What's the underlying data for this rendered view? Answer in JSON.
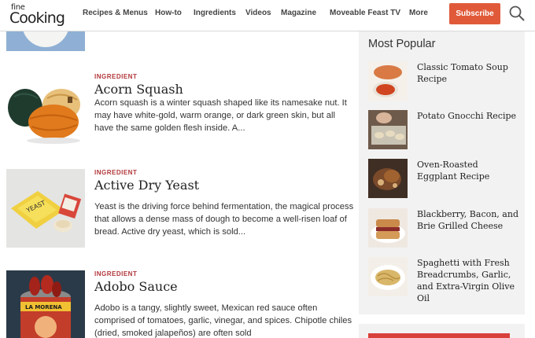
{
  "header": {
    "logo_small": "fine",
    "logo_big": "Cooking",
    "nav": [
      "Recipes & Menus",
      "How-to",
      "Ingredients",
      "Videos",
      "Magazine",
      "Moveable Feast TV",
      "More"
    ],
    "subscribe_label": "Subscribe"
  },
  "articles": [
    {
      "kicker": "INGREDIENT",
      "title": "Acorn Squash",
      "description": "Acorn squash is a winter squash shaped like its namesake nut. It may have white-gold, warm orange, or dark green skin, but all have the same golden flesh inside. A..."
    },
    {
      "kicker": "INGREDIENT",
      "title": "Active Dry Yeast",
      "description": "Yeast is the driving force behind fermentation, the magical process that allows a dense mass of dough to become a well-risen loaf of bread. Active dry yeast, which is sold..."
    },
    {
      "kicker": "INGREDIENT",
      "title": "Adobo Sauce",
      "description": "Adobo is a tangy, slightly sweet, Mexican red sauce often comprised of tomatoes, garlic, vinegar, and spices. Chipotle chiles (dried, smoked jalapeños) are often sold"
    }
  ],
  "sidebar": {
    "title": "Most Popular",
    "items": [
      {
        "title": "Classic Tomato Soup Recipe"
      },
      {
        "title": "Potato Gnocchi Recipe"
      },
      {
        "title": "Oven-Roasted Eggplant Recipe"
      },
      {
        "title": "Blackberry, Bacon, and Brie Grilled Cheese"
      },
      {
        "title": "Spaghetti with Fresh Breadcrumbs, Garlic, and Extra-Virgin Olive Oil"
      }
    ]
  },
  "colors": {
    "accent": "#e05a3a",
    "kicker": "#b2363a",
    "sidebar_bg": "#f2f2f2"
  },
  "icons": [
    "search-icon"
  ]
}
